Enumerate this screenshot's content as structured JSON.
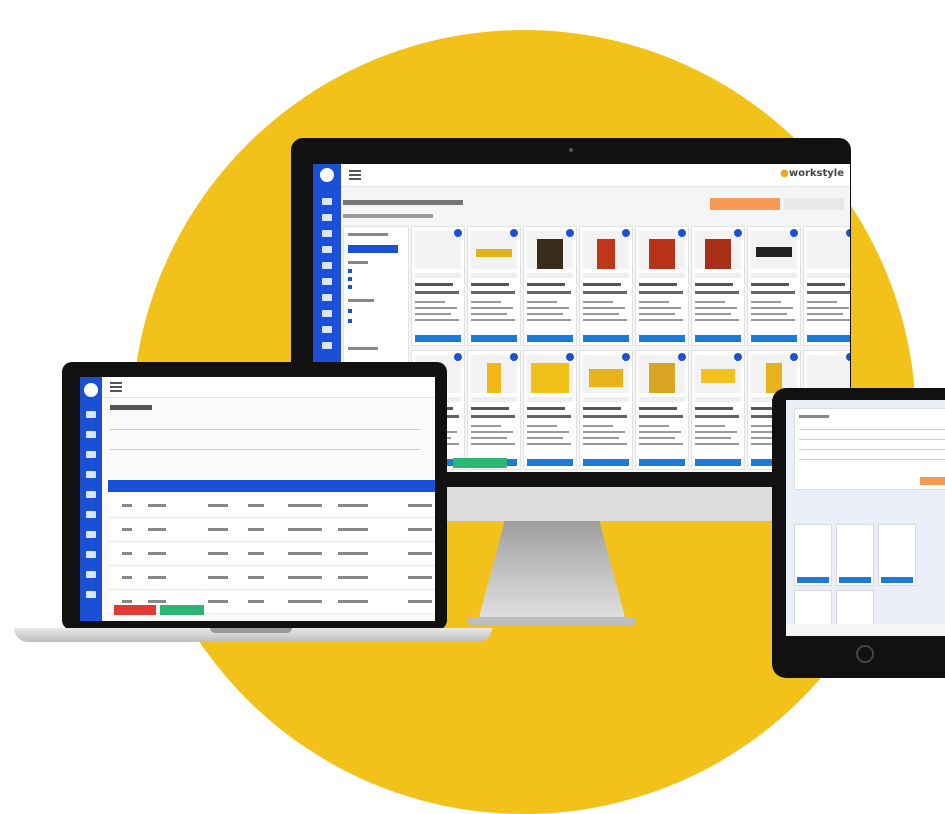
{
  "monitor": {
    "brand_logo": "workstyle",
    "order_button_label": "",
    "chart_hint": "",
    "cards": 8,
    "bottom_button_label": ""
  },
  "laptop": {
    "page_title": ""
  },
  "tablet": {}
}
